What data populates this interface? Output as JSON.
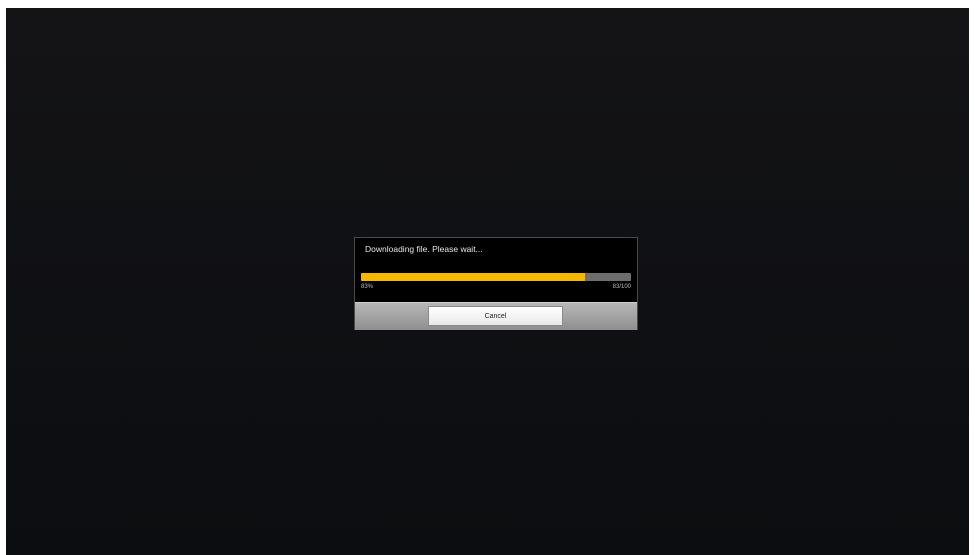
{
  "dialog": {
    "message": "Downloading file. Please wait...",
    "progress_fraction": 0.83,
    "percent_text": "83%",
    "count_text": "83/100",
    "cancel_label": "Cancel"
  },
  "colors": {
    "progress_fill": "#f5b800",
    "progress_track": "#6e6e6e",
    "background": "#0f1013"
  }
}
